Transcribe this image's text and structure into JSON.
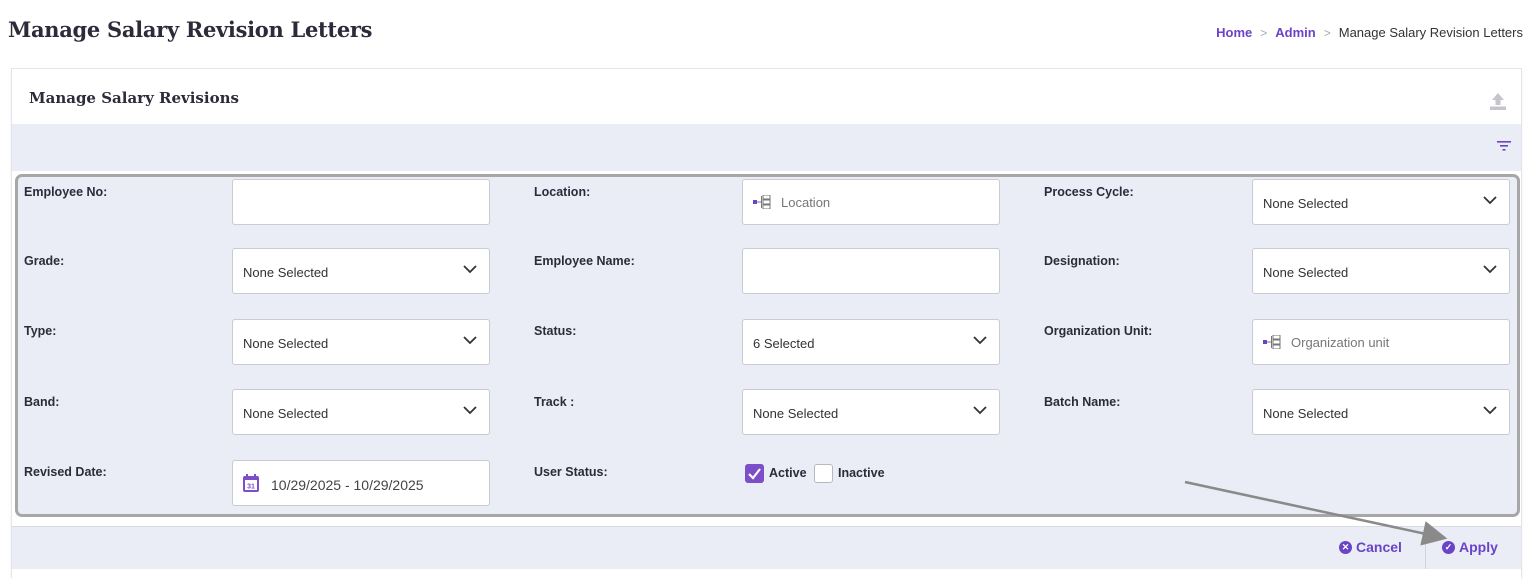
{
  "page": {
    "title": "Manage Salary Revision Letters",
    "breadcrumb": [
      {
        "label": "Home",
        "link": true
      },
      {
        "label": "Admin",
        "link": true
      },
      {
        "label": "Manage Salary Revision Letters",
        "link": false
      }
    ]
  },
  "card": {
    "title": "Manage Salary Revisions",
    "upload_icon": "upload-icon",
    "filter_icon": "filter-icon"
  },
  "form": {
    "employee_no": {
      "label": "Employee No:",
      "value": ""
    },
    "location": {
      "label": "Location:",
      "placeholder": "Location"
    },
    "process_cycle": {
      "label": "Process Cycle:",
      "value": "None Selected"
    },
    "grade": {
      "label": "Grade:",
      "value": "None Selected"
    },
    "employee_name": {
      "label": "Employee Name:",
      "value": ""
    },
    "designation": {
      "label": "Designation:",
      "value": "None Selected"
    },
    "type": {
      "label": "Type:",
      "value": "None Selected"
    },
    "status": {
      "label": "Status:",
      "value": "6 Selected"
    },
    "organization_unit": {
      "label": "Organization Unit:",
      "placeholder": "Organization unit"
    },
    "band": {
      "label": "Band:",
      "value": "None Selected"
    },
    "track": {
      "label": "Track :",
      "value": "None Selected"
    },
    "batch_name": {
      "label": "Batch Name:",
      "value": "None Selected"
    },
    "revised_date": {
      "label": "Revised Date:",
      "value": "10/29/2025 - 10/29/2025"
    },
    "user_status": {
      "label": "User Status:",
      "options": [
        {
          "label": "Active",
          "checked": true
        },
        {
          "label": "Inactive",
          "checked": false
        }
      ]
    }
  },
  "actions": {
    "cancel_label": "Cancel",
    "apply_label": "Apply"
  },
  "colors": {
    "accent": "#6a43c7",
    "panel_bg": "#eaedf5",
    "checkbox_on": "#7c4fc9"
  }
}
